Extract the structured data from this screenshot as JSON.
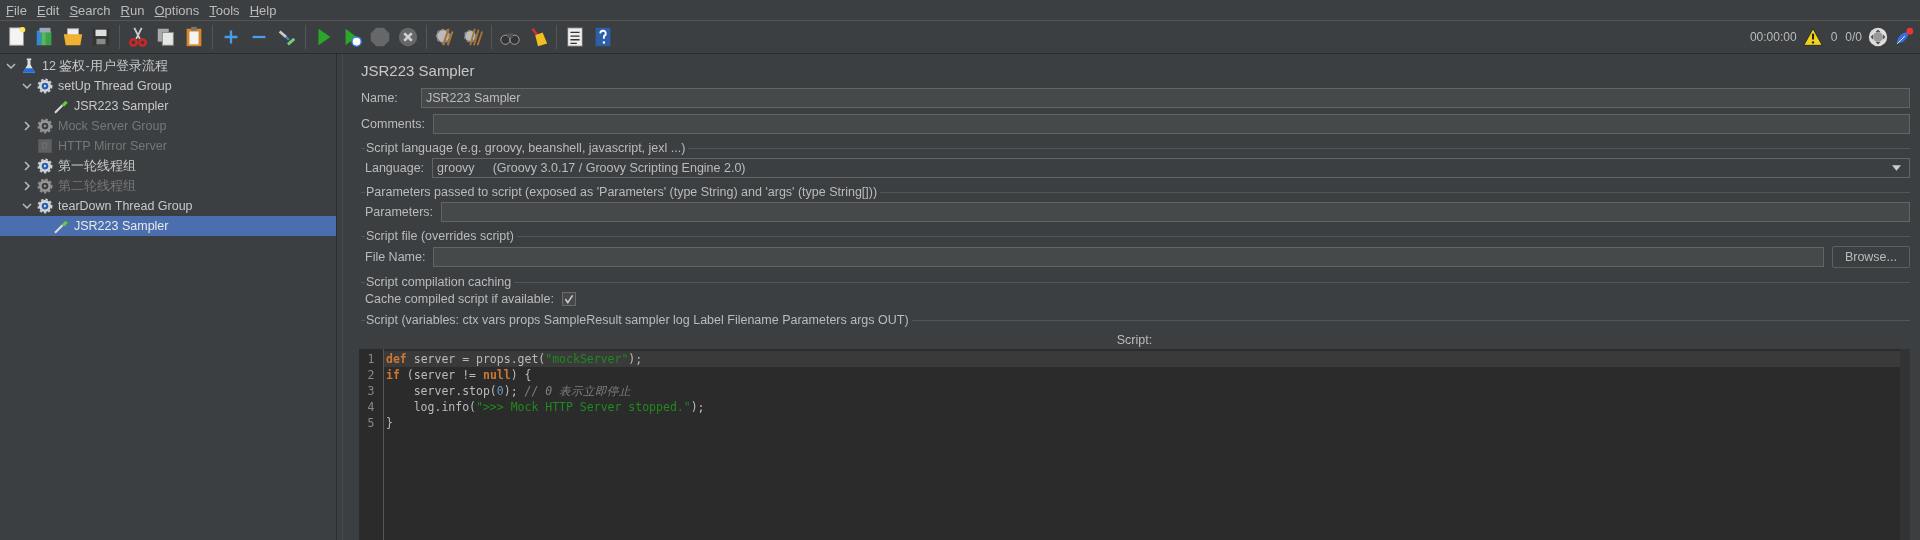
{
  "menu": [
    "File",
    "Edit",
    "Search",
    "Run",
    "Options",
    "Tools",
    "Help"
  ],
  "toolbar": [
    [
      {
        "kind": "new",
        "disabled": false
      },
      {
        "kind": "templates",
        "disabled": false
      },
      {
        "kind": "open",
        "disabled": false
      },
      {
        "kind": "save",
        "disabled": false
      }
    ],
    [
      {
        "kind": "cut",
        "disabled": false
      },
      {
        "kind": "copy",
        "disabled": false
      },
      {
        "kind": "paste",
        "disabled": false
      }
    ],
    [
      {
        "kind": "expand",
        "disabled": false
      },
      {
        "kind": "collapse",
        "disabled": false
      },
      {
        "kind": "toggle",
        "disabled": false
      }
    ],
    [
      {
        "kind": "start",
        "disabled": false
      },
      {
        "kind": "start-no-timers",
        "disabled": false
      },
      {
        "kind": "stop",
        "disabled": true
      },
      {
        "kind": "shutdown",
        "disabled": true
      }
    ],
    [
      {
        "kind": "clear",
        "disabled": false
      },
      {
        "kind": "clear-all",
        "disabled": false
      }
    ],
    [
      {
        "kind": "search",
        "disabled": false
      },
      {
        "kind": "reset-search",
        "disabled": false
      }
    ],
    [
      {
        "kind": "functions",
        "disabled": false
      },
      {
        "kind": "help",
        "disabled": false
      }
    ]
  ],
  "status": {
    "timer": "00:00:00",
    "warnings": "0",
    "threads": "0/0"
  },
  "tree": [
    {
      "kind": "plan",
      "label": "12 鉴权-用户登录流程",
      "expanded": true,
      "disabled": false,
      "selected": false,
      "children": [
        {
          "kind": "group",
          "label": "setUp Thread Group",
          "expanded": true,
          "disabled": false,
          "selected": false,
          "children": [
            {
              "kind": "sampler",
              "label": "JSR223 Sampler",
              "disabled": false,
              "selected": false
            }
          ]
        },
        {
          "kind": "group",
          "label": "Mock Server Group",
          "expanded": false,
          "disabled": true,
          "selected": false
        },
        {
          "kind": "mirror",
          "label": "HTTP Mirror Server",
          "disabled": true,
          "selected": false
        },
        {
          "kind": "group",
          "label": "第一轮线程组",
          "expanded": false,
          "disabled": false,
          "selected": false
        },
        {
          "kind": "group",
          "label": "第二轮线程组",
          "expanded": false,
          "disabled": true,
          "selected": false
        },
        {
          "kind": "group",
          "label": "tearDown Thread Group",
          "expanded": true,
          "disabled": false,
          "selected": false,
          "children": [
            {
              "kind": "sampler",
              "label": "JSR223 Sampler",
              "disabled": false,
              "selected": true
            }
          ]
        }
      ]
    }
  ],
  "panel": {
    "title": "JSR223 Sampler",
    "name": {
      "label": "Name:",
      "value": "JSR223 Sampler"
    },
    "comments": {
      "label": "Comments:"
    },
    "sections": [
      {
        "kind": "language",
        "title": "Script language (e.g. groovy, beanshell, javascript, jexl ...)",
        "label": "Language:",
        "value": "groovy",
        "detail": "(Groovy 3.0.17 / Groovy Scripting Engine 2.0)"
      },
      {
        "kind": "text",
        "title": "Parameters passed to script (exposed as 'Parameters' (type String) and 'args' (type String[]))",
        "label": "Parameters:"
      },
      {
        "kind": "file",
        "title": "Script file (overrides script)",
        "label": "File Name:",
        "button": "Browse..."
      },
      {
        "kind": "checkbox",
        "title": "Script compilation caching",
        "label": "Cache compiled script if available:",
        "checked": true
      },
      {
        "kind": "script",
        "title": "Script (variables: ctx vars props SampleResult sampler log Label Filename Parameters args OUT)",
        "label": "Script:",
        "lines": [
          {
            "number": "1",
            "current": true,
            "tokens": [
              {
                "kind": "keyword",
                "text": "def"
              },
              {
                "kind": "plain",
                "text": " server = props.get("
              },
              {
                "kind": "string",
                "text": "\"mockServer\""
              },
              {
                "kind": "plain",
                "text": ");"
              }
            ]
          },
          {
            "number": "2",
            "current": false,
            "tokens": [
              {
                "kind": "keyword",
                "text": "if"
              },
              {
                "kind": "plain",
                "text": " (server != "
              },
              {
                "kind": "keyword",
                "text": "null"
              },
              {
                "kind": "plain",
                "text": ") {"
              }
            ]
          },
          {
            "number": "3",
            "current": false,
            "tokens": [
              {
                "kind": "plain",
                "text": "    server.stop("
              },
              {
                "kind": "number",
                "text": "0"
              },
              {
                "kind": "plain",
                "text": "); "
              },
              {
                "kind": "comment",
                "text": "// 0 表示立即停止"
              }
            ]
          },
          {
            "number": "4",
            "current": false,
            "tokens": [
              {
                "kind": "plain",
                "text": "    log.info("
              },
              {
                "kind": "string",
                "text": "\">>> Mock HTTP Server stopped.\""
              },
              {
                "kind": "plain",
                "text": ");"
              }
            ]
          },
          {
            "number": "5",
            "current": false,
            "tokens": [
              {
                "kind": "plain",
                "text": "}"
              }
            ]
          }
        ]
      }
    ]
  }
}
